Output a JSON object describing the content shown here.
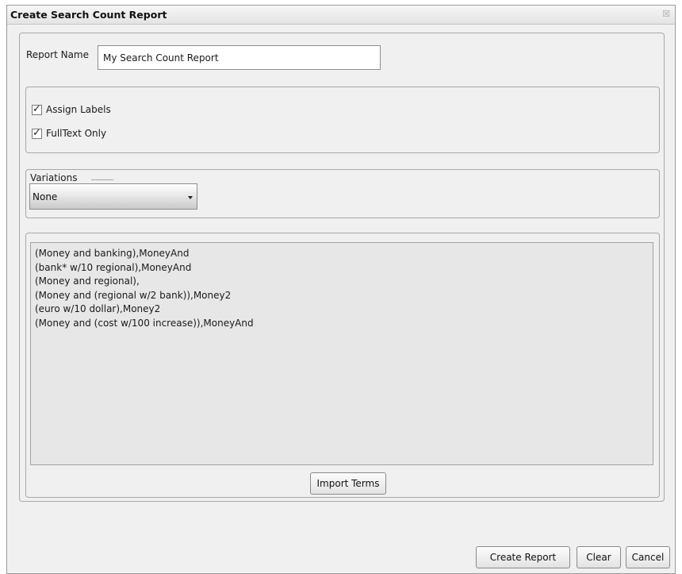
{
  "dialog": {
    "title": "Create Search Count Report",
    "close_glyph": "☒"
  },
  "report_name": {
    "label": "Report Name",
    "value": "My Search Count Report"
  },
  "options": {
    "assign_labels": {
      "label": "Assign Labels",
      "checked": true
    },
    "fulltext_only": {
      "label": "FullText Only",
      "checked": true
    },
    "check_glyph": "✓"
  },
  "variations": {
    "legend": "Variations",
    "selected": "None"
  },
  "terms": [
    "(Money and banking),MoneyAnd",
    "(bank* w/10 regional),MoneyAnd",
    "(Money and regional),",
    "(Money and (regional w/2 bank)),Money2",
    "(euro w/10 dollar),Money2",
    "(Money and (cost w/100 increase)),MoneyAnd"
  ],
  "buttons": {
    "import_terms": "Import Terms",
    "create_report": "Create Report",
    "clear": "Clear",
    "cancel": "Cancel"
  }
}
